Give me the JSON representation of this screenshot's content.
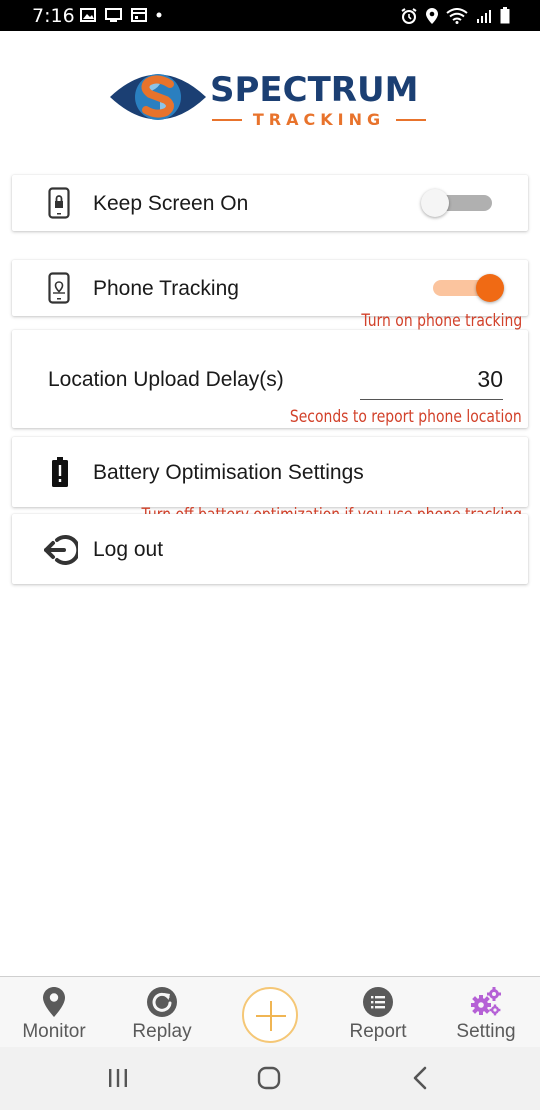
{
  "status_bar": {
    "time": "7:16"
  },
  "logo": {
    "word": "SPECTRUM",
    "sub": "TRACKING"
  },
  "settings": {
    "keep_screen_on": {
      "label": "Keep Screen On",
      "enabled": false
    },
    "phone_tracking": {
      "label": "Phone Tracking",
      "enabled": true,
      "hint": "Turn on phone tracking"
    },
    "upload_delay": {
      "label": "Location Upload Delay(s)",
      "value": "30",
      "hint": "Seconds to report phone location"
    },
    "battery": {
      "label": "Battery Optimisation Settings",
      "hint": "Turn off battery optimization if you use phone tracking"
    },
    "logout": {
      "label": "Log out"
    }
  },
  "bottom_nav": {
    "items": [
      {
        "label": "Monitor",
        "icon": "map-pin-icon"
      },
      {
        "label": "Replay",
        "icon": "replay-icon"
      },
      {
        "label": "",
        "icon": "plus-icon"
      },
      {
        "label": "Report",
        "icon": "list-icon"
      },
      {
        "label": "Setting",
        "icon": "gears-icon",
        "active": true
      }
    ]
  },
  "colors": {
    "brand_navy": "#1b3f73",
    "brand_orange": "#e8732c",
    "toggle_on": "#f06a14",
    "hint_red": "#d2412a",
    "active_tab": "#b561d6"
  }
}
